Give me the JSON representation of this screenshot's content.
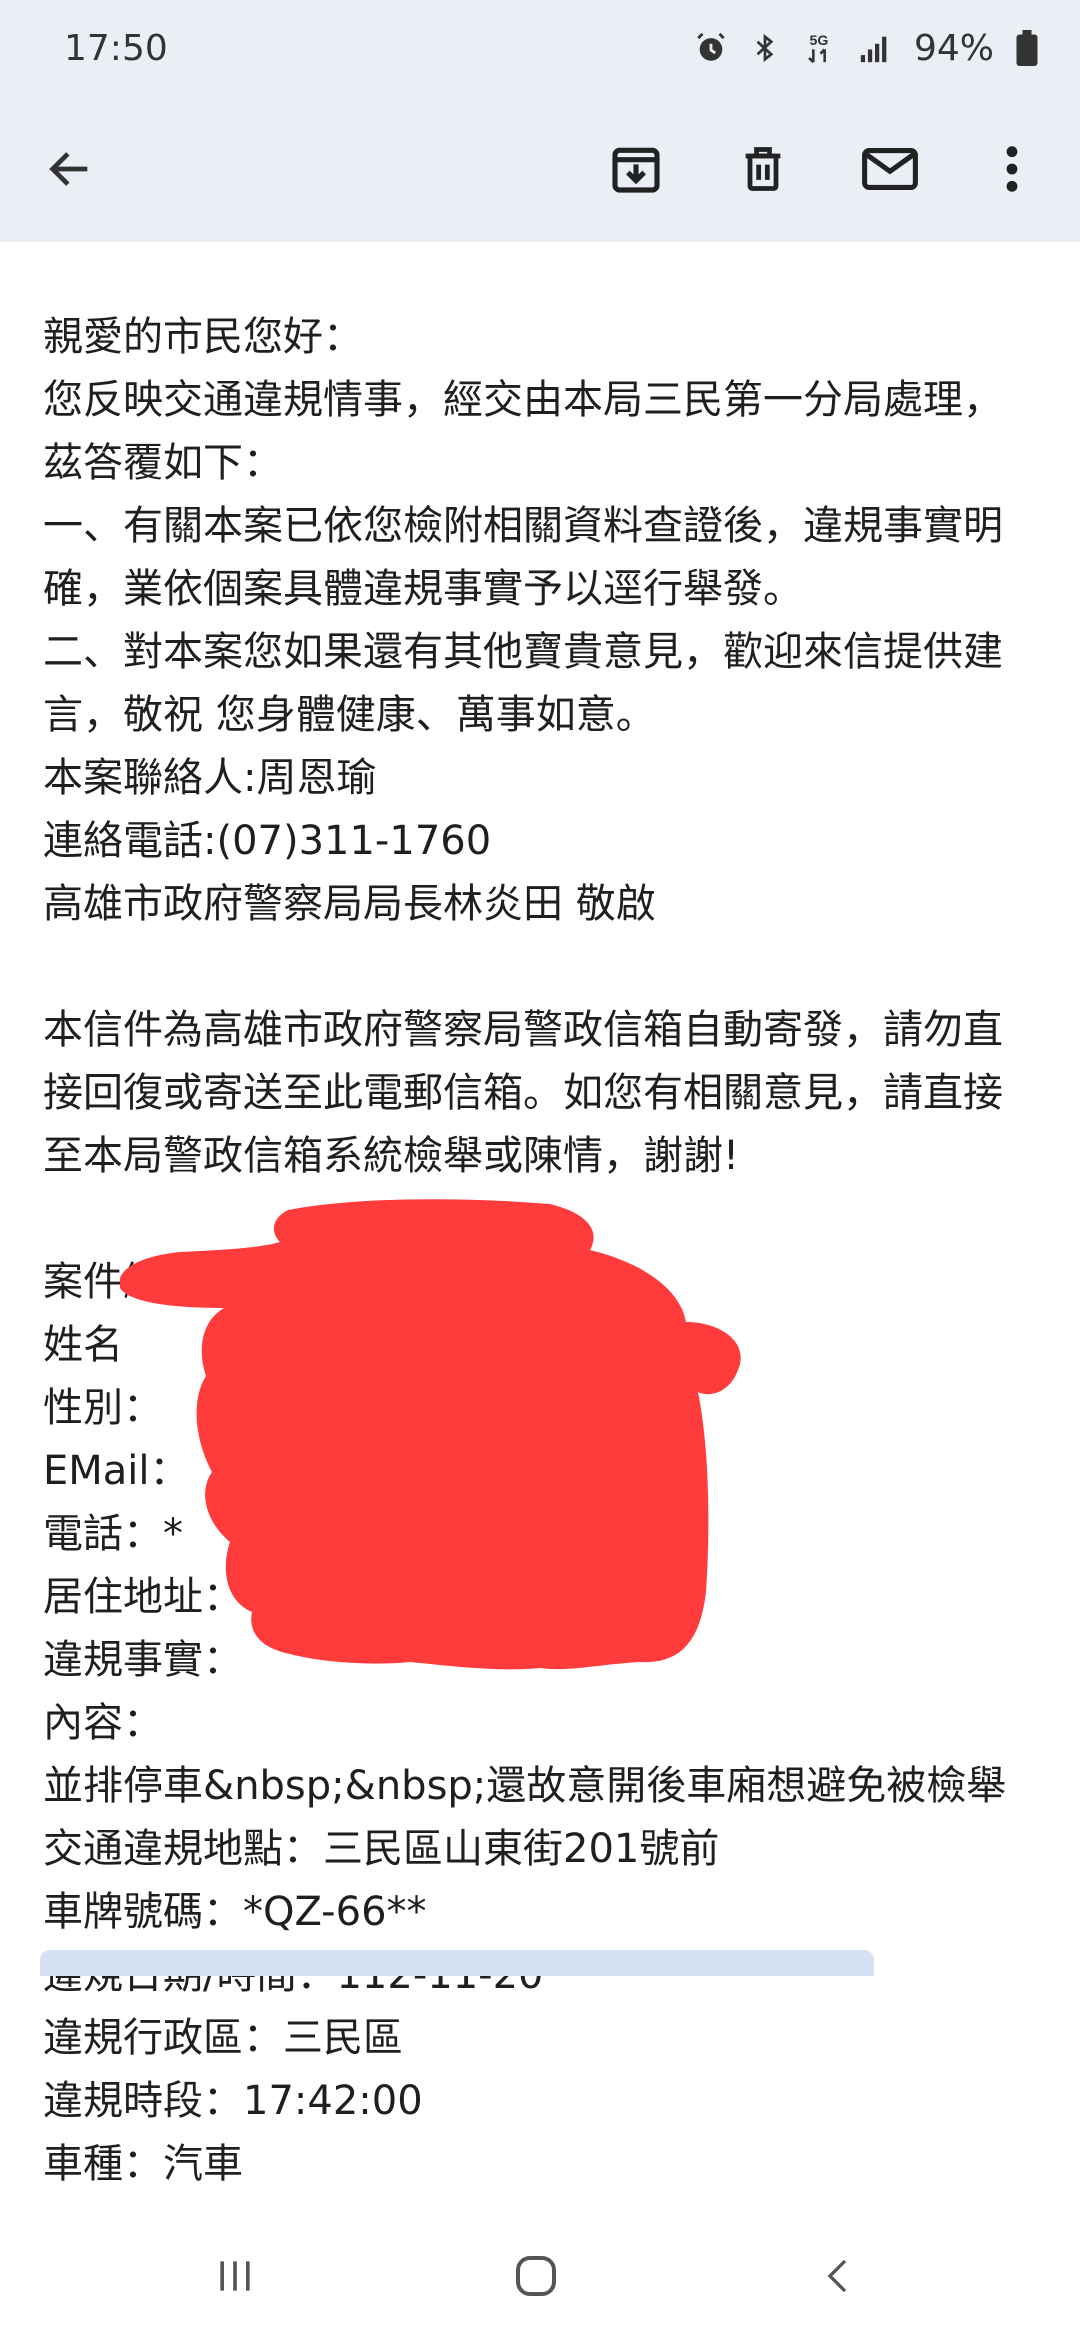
{
  "status_bar": {
    "time": "17:50",
    "network_label": "5G",
    "battery": "94%",
    "icons": [
      "alarm-icon",
      "bluetooth-icon",
      "network-5g-icon",
      "signal-icon",
      "battery-icon"
    ]
  },
  "toolbar": {
    "icons": [
      "back-arrow-icon",
      "archive-icon",
      "delete-icon",
      "mark-unread-icon",
      "more-vert-icon"
    ]
  },
  "email": {
    "lines": [
      "親愛的市民您好：",
      "您反映交通違規情事，經交由本局三民第一分局處理，",
      "茲答覆如下：",
      "一、有關本案已依您檢附相關資料查證後，違規事實明",
      "確，業依個案具體違規事實予以逕行舉發。",
      "二、對本案您如果還有其他寶貴意見，歡迎來信提供建",
      "言，敬祝 您身體健康、萬事如意。",
      "本案聯絡人:周恩瑜",
      "連絡電話:(07)311-1760",
      "高雄市政府警察局局長林炎田 敬啟"
    ],
    "notice_lines": [
      "本信件為高雄市政府警察局警政信箱自動寄發，請勿直",
      "接回復或寄送至此電郵信箱。如您有相關意見，請直接",
      "至本局警政信箱系統檢舉或陳情，謝謝!"
    ],
    "fields": [
      "案件編號：",
      "姓名",
      "性別：",
      "EMail：",
      "電話：*",
      "居住地址：",
      "違規事實：",
      "內容：",
      "並排停車&nbsp;&nbsp;還故意開後車廂想避免被檢舉",
      "交通違規地點：三民區山東街201號前",
      "車牌號碼：*QZ-66**",
      "違規日期/時間：112-11-20",
      "違規行政區：三民區",
      "違規時段：17:42:00",
      "車種：汽車"
    ]
  },
  "colors": {
    "header_bg": "#eaeef5",
    "redaction": "#ff3b3b",
    "attachment_strip": "#d6e2f3"
  },
  "nav_bar": {
    "icons": [
      "recents-icon",
      "home-icon",
      "back-icon"
    ]
  }
}
